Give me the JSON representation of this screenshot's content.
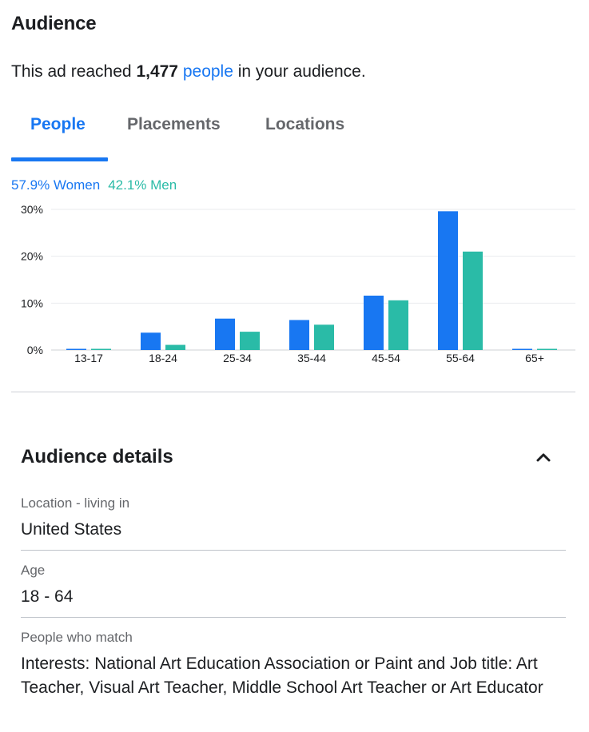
{
  "audience": {
    "title": "Audience",
    "reach_prefix": "This ad reached ",
    "reach_count": "1,477",
    "reach_link": "people",
    "reach_suffix": " in your audience."
  },
  "tabs": [
    {
      "label": "People",
      "active": true
    },
    {
      "label": "Placements",
      "active": false
    },
    {
      "label": "Locations",
      "active": false
    }
  ],
  "gender": {
    "women": "57.9% Women",
    "men": "42.1% Men"
  },
  "colors": {
    "women": "#1877f2",
    "men": "#2abba7",
    "accent": "#1877f2"
  },
  "chart_data": {
    "type": "bar",
    "categories": [
      "13-17",
      "18-24",
      "25-34",
      "35-44",
      "45-54",
      "55-64",
      "65+"
    ],
    "series": [
      {
        "name": "Women",
        "values": [
          0.2,
          3.7,
          6.7,
          6.4,
          11.6,
          29.6,
          0.2
        ]
      },
      {
        "name": "Men",
        "values": [
          0.2,
          1.1,
          3.9,
          5.4,
          10.6,
          21.0,
          0.2
        ]
      }
    ],
    "yticks": [
      "0%",
      "10%",
      "20%",
      "30%"
    ],
    "ylim": [
      0,
      30
    ],
    "grid": true,
    "legend": "top-left"
  },
  "details": {
    "title": "Audience details",
    "chevron_icon": "chevron-up-icon",
    "fields": [
      {
        "label": "Location - living in",
        "value": "United States"
      },
      {
        "label": "Age",
        "value": "18 - 64"
      },
      {
        "label": "People who match",
        "value": "Interests: National Art Education Association or Paint and Job title: Art Teacher, Visual Art Teacher, Middle School Art Teacher or Art Educator"
      }
    ]
  }
}
